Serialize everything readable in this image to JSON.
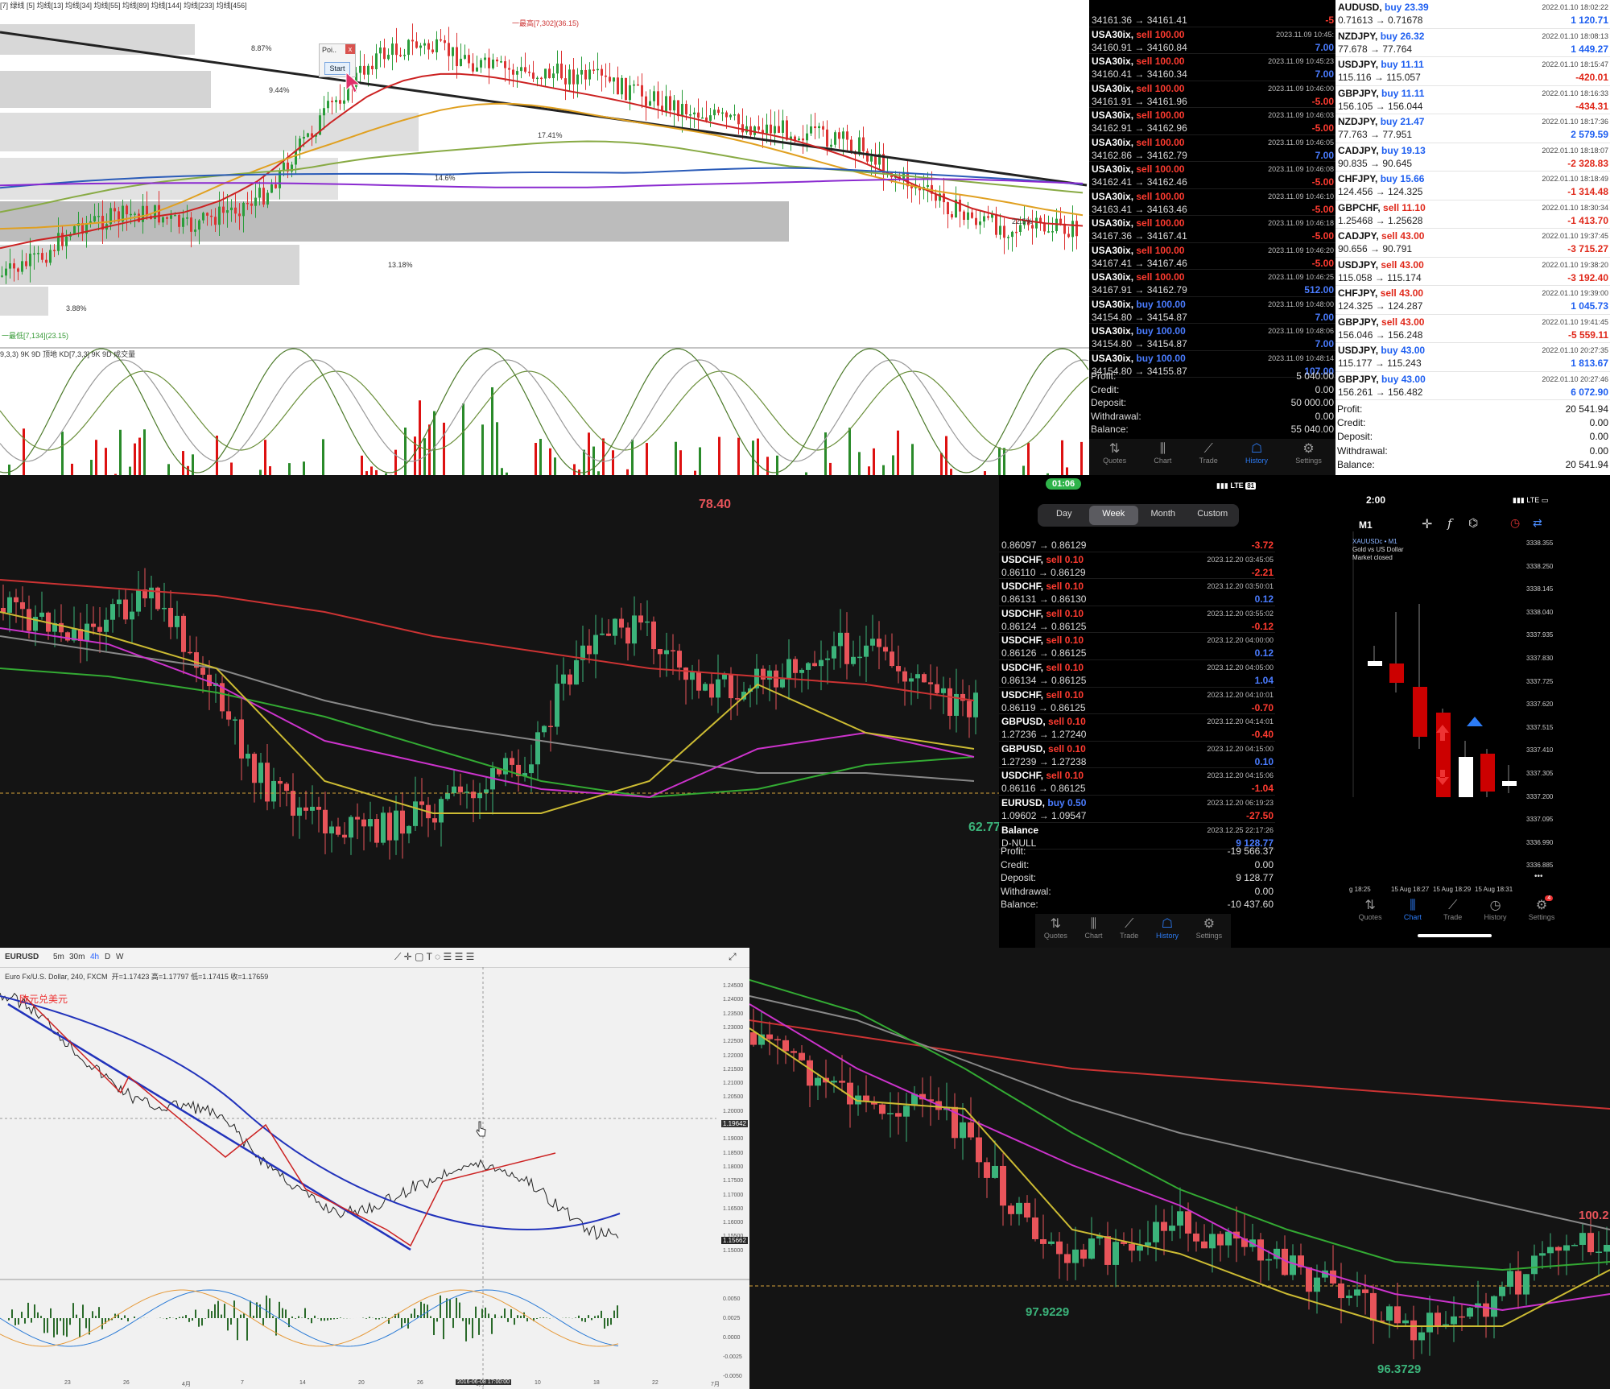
{
  "mt4_chart_top": {
    "legend": "[7] 绿线 [5] 均线[13] 均线[34] 均线[55] 均线[89] 均线[144] 均线[233] 均线[456]",
    "osc_label": "9,3,3) 9K 9D 顶地 KD[7,3,3] 9K 9D 成交量",
    "fib_levels": [
      "8.87%",
      "9.44%",
      "17.41%",
      "14.6%",
      "22.5%",
      "13.18%",
      "3.88%"
    ],
    "high_label": "一最高[7,302](36.15)",
    "low_label": "一最低[7,134](23.15)",
    "popup_title": "Poi..",
    "popup_close": "x",
    "popup_button": "Start"
  },
  "history1": {
    "rows": [
      {
        "sym": "",
        "side": "",
        "vol": "",
        "time": "",
        "prices": "34161.36 → 34161.41",
        "profit": "-5",
        "sign": "neg"
      },
      {
        "sym": "USA30ix,",
        "side": "sell",
        "vol": "100.00",
        "time": "2023.11.09 10:45:",
        "prices": "34160.91 → 34160.84",
        "profit": "7.00",
        "sign": "pos"
      },
      {
        "sym": "USA30ix,",
        "side": "sell",
        "vol": "100.00",
        "time": "2023.11.09 10:45:23",
        "prices": "34160.41 → 34160.34",
        "profit": "7.00",
        "sign": "pos"
      },
      {
        "sym": "USA30ix,",
        "side": "sell",
        "vol": "100.00",
        "time": "2023.11.09 10:46:00",
        "prices": "34161.91 → 34161.96",
        "profit": "-5.00",
        "sign": "neg"
      },
      {
        "sym": "USA30ix,",
        "side": "sell",
        "vol": "100.00",
        "time": "2023.11.09 10:46:03",
        "prices": "34162.91 → 34162.96",
        "profit": "-5.00",
        "sign": "neg"
      },
      {
        "sym": "USA30ix,",
        "side": "sell",
        "vol": "100.00",
        "time": "2023.11.09 10:46:05",
        "prices": "34162.86 → 34162.79",
        "profit": "7.00",
        "sign": "pos"
      },
      {
        "sym": "USA30ix,",
        "side": "sell",
        "vol": "100.00",
        "time": "2023.11.09 10:46:08",
        "prices": "34162.41 → 34162.46",
        "profit": "-5.00",
        "sign": "neg"
      },
      {
        "sym": "USA30ix,",
        "side": "sell",
        "vol": "100.00",
        "time": "2023.11.09 10:46:10",
        "prices": "34163.41 → 34163.46",
        "profit": "-5.00",
        "sign": "neg"
      },
      {
        "sym": "USA30ix,",
        "side": "sell",
        "vol": "100.00",
        "time": "2023.11.09 10:46:18",
        "prices": "34167.36 → 34167.41",
        "profit": "-5.00",
        "sign": "neg"
      },
      {
        "sym": "USA30ix,",
        "side": "sell",
        "vol": "100.00",
        "time": "2023.11.09 10:46:20",
        "prices": "34167.41 → 34167.46",
        "profit": "-5.00",
        "sign": "neg"
      },
      {
        "sym": "USA30ix,",
        "side": "sell",
        "vol": "100.00",
        "time": "2023.11.09 10:46:25",
        "prices": "34167.91 → 34162.79",
        "profit": "512.00",
        "sign": "pos"
      },
      {
        "sym": "USA30ix,",
        "side": "buy",
        "vol": "100.00",
        "time": "2023.11.09 10:48:00",
        "prices": "34154.80 → 34154.87",
        "profit": "7.00",
        "sign": "pos"
      },
      {
        "sym": "USA30ix,",
        "side": "buy",
        "vol": "100.00",
        "time": "2023.11.09 10:48:06",
        "prices": "34154.80 → 34154.87",
        "profit": "7.00",
        "sign": "pos"
      },
      {
        "sym": "USA30ix,",
        "side": "buy",
        "vol": "100.00",
        "time": "2023.11.09 10:48:14",
        "prices": "34154.80 → 34155.87",
        "profit": "107.00",
        "sign": "pos"
      }
    ],
    "summary": [
      {
        "label": "Profit:",
        "value": "5 040.00"
      },
      {
        "label": "Credit:",
        "value": "0.00"
      },
      {
        "label": "Deposit:",
        "value": "50 000.00"
      },
      {
        "label": "Withdrawal:",
        "value": "0.00"
      },
      {
        "label": "Balance:",
        "value": "55 040.00"
      }
    ],
    "tabs": [
      {
        "label": "Quotes",
        "icon": "⇅"
      },
      {
        "label": "Chart",
        "icon": "⫼"
      },
      {
        "label": "Trade",
        "icon": "⟋"
      },
      {
        "label": "History",
        "icon": "☖"
      },
      {
        "label": "Settings",
        "icon": "⚙"
      }
    ]
  },
  "history2": {
    "rows": [
      {
        "sym": "AUDUSD,",
        "side": "buy",
        "vol": "23.39",
        "time": "2022.01.10 18:02:22",
        "prices": "0.71613 → 0.71678",
        "profit": "1 120.71",
        "sign": "pos"
      },
      {
        "sym": "NZDJPY,",
        "side": "buy",
        "vol": "26.32",
        "time": "2022.01.10 18:08:13",
        "prices": "77.678 → 77.764",
        "profit": "1 449.27",
        "sign": "pos"
      },
      {
        "sym": "USDJPY,",
        "side": "buy",
        "vol": "11.11",
        "time": "2022.01.10 18:15:47",
        "prices": "115.116 → 115.057",
        "profit": "-420.01",
        "sign": "neg"
      },
      {
        "sym": "GBPJPY,",
        "side": "buy",
        "vol": "11.11",
        "time": "2022.01.10 18:16:33",
        "prices": "156.105 → 156.044",
        "profit": "-434.31",
        "sign": "neg"
      },
      {
        "sym": "NZDJPY,",
        "side": "buy",
        "vol": "21.47",
        "time": "2022.01.10 18:17:36",
        "prices": "77.763 → 77.951",
        "profit": "2 579.59",
        "sign": "pos"
      },
      {
        "sym": "CADJPY,",
        "side": "buy",
        "vol": "19.13",
        "time": "2022.01.10 18:18:07",
        "prices": "90.835 → 90.645",
        "profit": "-2 328.83",
        "sign": "neg"
      },
      {
        "sym": "CHFJPY,",
        "side": "buy",
        "vol": "15.66",
        "time": "2022.01.10 18:18:49",
        "prices": "124.456 → 124.325",
        "profit": "-1 314.48",
        "sign": "neg"
      },
      {
        "sym": "GBPCHF,",
        "side": "sell",
        "vol": "11.10",
        "time": "2022.01.10 18:30:34",
        "prices": "1.25468 → 1.25628",
        "profit": "-1 413.70",
        "sign": "neg"
      },
      {
        "sym": "CADJPY,",
        "side": "sell",
        "vol": "43.00",
        "time": "2022.01.10 19:37:45",
        "prices": "90.656 → 90.791",
        "profit": "-3 715.27",
        "sign": "neg"
      },
      {
        "sym": "USDJPY,",
        "side": "sell",
        "vol": "43.00",
        "time": "2022.01.10 19:38:20",
        "prices": "115.058 → 115.174",
        "profit": "-3 192.40",
        "sign": "neg"
      },
      {
        "sym": "CHFJPY,",
        "side": "sell",
        "vol": "43.00",
        "time": "2022.01.10 19:39:00",
        "prices": "124.325 → 124.287",
        "profit": "1 045.73",
        "sign": "pos"
      },
      {
        "sym": "GBPJPY,",
        "side": "sell",
        "vol": "43.00",
        "time": "2022.01.10 19:41:45",
        "prices": "156.046 → 156.248",
        "profit": "-5 559.11",
        "sign": "neg"
      },
      {
        "sym": "USDJPY,",
        "side": "buy",
        "vol": "43.00",
        "time": "2022.01.10 20:27:35",
        "prices": "115.177 → 115.243",
        "profit": "1 813.67",
        "sign": "pos"
      },
      {
        "sym": "GBPJPY,",
        "side": "buy",
        "vol": "43.00",
        "time": "2022.01.10 20:27:46",
        "prices": "156.261 → 156.482",
        "profit": "6 072.90",
        "sign": "pos"
      }
    ],
    "summary": [
      {
        "label": "Profit:",
        "value": "20 541.94"
      },
      {
        "label": "Credit:",
        "value": "0.00"
      },
      {
        "label": "Deposit:",
        "value": "0.00"
      },
      {
        "label": "Withdrawal:",
        "value": "0.00"
      },
      {
        "label": "Balance:",
        "value": "20 541.94"
      }
    ]
  },
  "chart_mid": {
    "high_label": "78.40",
    "low_label": "62.77"
  },
  "history3": {
    "status_time": "01:06",
    "status_net": "LTE",
    "status_batt": "81",
    "segments": [
      "Day",
      "Week",
      "Month",
      "Custom"
    ],
    "active_segment": "Week",
    "rows": [
      {
        "sym": "",
        "side": "",
        "vol": "",
        "time": "",
        "prices": "0.86097 → 0.86129",
        "profit": "-3.72",
        "sign": "neg"
      },
      {
        "sym": "USDCHF,",
        "side": "sell",
        "vol": "0.10",
        "time": "2023.12.20 03:45:05",
        "prices": "0.86110 → 0.86129",
        "profit": "-2.21",
        "sign": "neg"
      },
      {
        "sym": "USDCHF,",
        "side": "sell",
        "vol": "0.10",
        "time": "2023.12.20 03:50:01",
        "prices": "0.86131 → 0.86130",
        "profit": "0.12",
        "sign": "pos"
      },
      {
        "sym": "USDCHF,",
        "side": "sell",
        "vol": "0.10",
        "time": "2023.12.20 03:55:02",
        "prices": "0.86124 → 0.86125",
        "profit": "-0.12",
        "sign": "neg"
      },
      {
        "sym": "USDCHF,",
        "side": "sell",
        "vol": "0.10",
        "time": "2023.12.20 04:00:00",
        "prices": "0.86126 → 0.86125",
        "profit": "0.12",
        "sign": "pos"
      },
      {
        "sym": "USDCHF,",
        "side": "sell",
        "vol": "0.10",
        "time": "2023.12.20 04:05:00",
        "prices": "0.86134 → 0.86125",
        "profit": "1.04",
        "sign": "pos"
      },
      {
        "sym": "USDCHF,",
        "side": "sell",
        "vol": "0.10",
        "time": "2023.12.20 04:10:01",
        "prices": "0.86119 → 0.86125",
        "profit": "-0.70",
        "sign": "neg"
      },
      {
        "sym": "GBPUSD,",
        "side": "sell",
        "vol": "0.10",
        "time": "2023.12.20 04:14:01",
        "prices": "1.27236 → 1.27240",
        "profit": "-0.40",
        "sign": "neg"
      },
      {
        "sym": "GBPUSD,",
        "side": "sell",
        "vol": "0.10",
        "time": "2023.12.20 04:15:00",
        "prices": "1.27239 → 1.27238",
        "profit": "0.10",
        "sign": "pos"
      },
      {
        "sym": "USDCHF,",
        "side": "sell",
        "vol": "0.10",
        "time": "2023.12.20 04:15:06",
        "prices": "0.86116 → 0.86125",
        "profit": "-1.04",
        "sign": "neg"
      },
      {
        "sym": "EURUSD,",
        "side": "buy",
        "vol": "0.50",
        "time": "2023.12.20 06:19:23",
        "prices": "1.09602 → 1.09547",
        "profit": "-27.50",
        "sign": "neg"
      },
      {
        "sym": "Balance",
        "side": "",
        "vol": "",
        "time": "2023.12.25 22:17:26",
        "prices": "D-NULL",
        "profit": "9 128.77",
        "sign": "pos"
      }
    ],
    "summary": [
      {
        "label": "Profit:",
        "value": "-19 566.37"
      },
      {
        "label": "Credit:",
        "value": "0.00"
      },
      {
        "label": "Deposit:",
        "value": "9 128.77"
      },
      {
        "label": "Withdrawal:",
        "value": "0.00"
      },
      {
        "label": "Balance:",
        "value": "-10 437.60"
      }
    ]
  },
  "phone_chart": {
    "status_time": "2:00",
    "status_net": "LTE",
    "timeframe": "M1",
    "symbol": "XAUUSDc • M1",
    "desc": "Gold vs US Dollar",
    "market": "Market closed",
    "price_ticks": [
      "3338.355",
      "3338.250",
      "3338.145",
      "3338.040",
      "3337.935",
      "3337.830",
      "3337.725",
      "3337.620",
      "3337.515",
      "3337.410",
      "3337.305",
      "3337.200",
      "3337.095",
      "3336.990",
      "3336.885"
    ],
    "time_ticks": [
      "g 18:25",
      "15 Aug 18:27",
      "15 Aug 18:29",
      "15 Aug 18:31"
    ],
    "more": "•••",
    "settings_badge": "4"
  },
  "tv_chart": {
    "symbol": "EURUSD",
    "timeframes": [
      "5m",
      "30m",
      "4h",
      "D",
      "W"
    ],
    "title": "Euro Fx/U.S. Dollar, 240, FXCM",
    "ohlc": "开=1.17423 高=1.17797 低=1.17415 收=1.17659",
    "annotation": "欧元兑美元",
    "price_ticks": [
      "1.24500",
      "1.24000",
      "1.23500",
      "1.23000",
      "1.22500",
      "1.22000",
      "1.21500",
      "1.21000",
      "1.20500",
      "1.20000",
      "1.19500",
      "1.19000",
      "1.18500",
      "1.18000",
      "1.17500",
      "1.17000",
      "1.16500",
      "1.16000",
      "1.15500",
      "1.15000"
    ],
    "current_price": "1.19642",
    "last_price": "1.15662",
    "osc_ticks": [
      "0.0050",
      "0.0025",
      "0.0000",
      "-0.0025",
      "-0.0050"
    ],
    "date_ticks": [
      "23",
      "26",
      "4月",
      "7",
      "14",
      "20",
      "26",
      "6月",
      "10",
      "18",
      "22",
      "7月"
    ],
    "date_badge": "2016-06-08 17:00:00"
  },
  "chart_bottom": {
    "high_label": "100.2",
    "low_label1": "97.9229",
    "low_label2": "96.3729"
  }
}
